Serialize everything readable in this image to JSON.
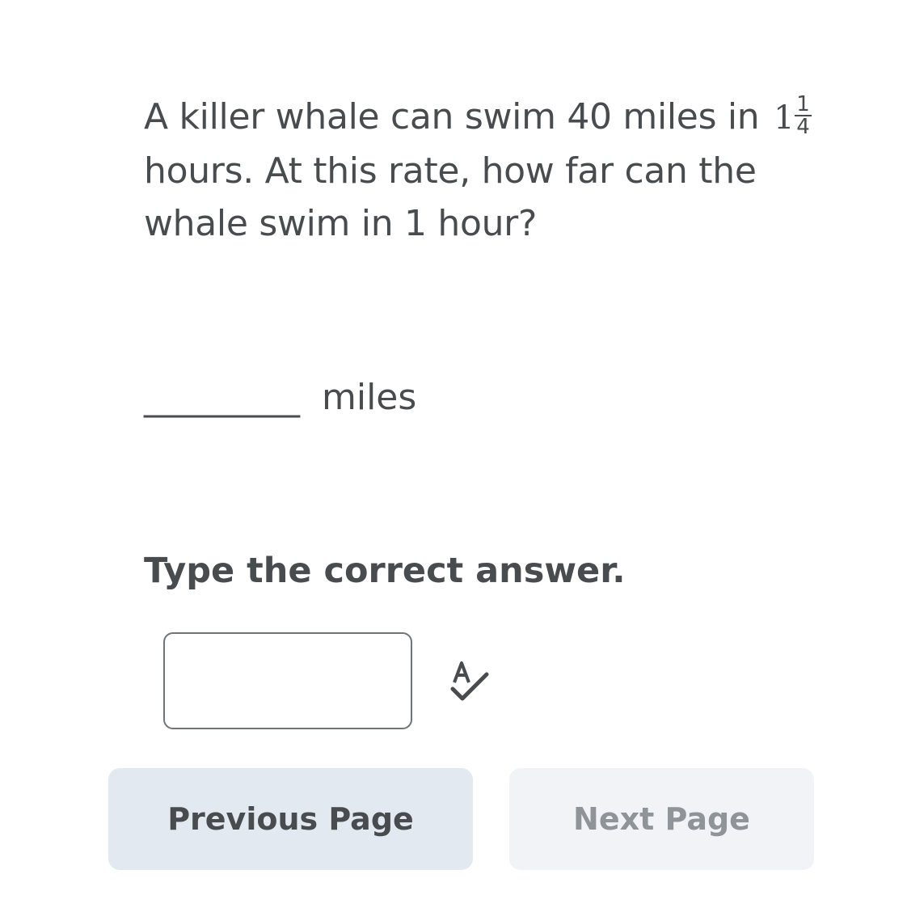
{
  "question": {
    "line1": "A killer whale can swim 40 miles in",
    "fraction": {
      "whole": "1",
      "numerator": "1",
      "denominator": "4"
    },
    "line2": "hours. At this rate, how far can the",
    "line3": "whale swim in 1 hour?"
  },
  "blank": {
    "underline": "__________",
    "unit": "miles"
  },
  "instruction": "Type the correct answer.",
  "answer_input": {
    "value": "",
    "placeholder": ""
  },
  "spellcheck_icon": "spellcheck-icon",
  "buttons": {
    "previous": "Previous Page",
    "next": "Next Page"
  }
}
